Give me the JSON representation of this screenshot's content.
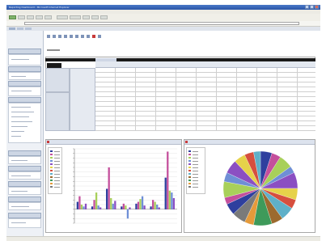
{
  "window": {
    "title": "Reporting Dashboard - Microsoft Internet Explorer"
  },
  "colors": {
    "palette": [
      "#2e3f9e",
      "#c44f9c",
      "#a8d05a",
      "#6f8fd6",
      "#8b4fc2",
      "#e6d24a",
      "#d64f3e",
      "#5fb0c8",
      "#9c6a2e",
      "#3e9a5a",
      "#e59a3a",
      "#7a7a7a"
    ]
  },
  "icons": [
    "back-icon",
    "forward-icon",
    "stop-icon",
    "refresh-icon",
    "home-icon",
    "search-icon",
    "favorites-icon",
    "history-icon",
    "mail-icon",
    "print-icon"
  ],
  "chart_data": [
    {
      "type": "bar",
      "categories": [
        "1",
        "2",
        "3",
        "4",
        "5",
        "6",
        "7"
      ],
      "series": [
        {
          "values": [
            8,
            3,
            22,
            3,
            6,
            3,
            34
          ]
        },
        {
          "values": [
            14,
            10,
            45,
            6,
            8,
            10,
            62
          ]
        },
        {
          "values": [
            5,
            18,
            12,
            4,
            11,
            8,
            20
          ]
        },
        {
          "values": [
            3,
            4,
            6,
            -10,
            14,
            5,
            18
          ]
        },
        {
          "values": [
            6,
            2,
            9,
            2,
            4,
            2,
            12
          ]
        }
      ],
      "ylim": [
        -15,
        65
      ]
    },
    {
      "type": "pie",
      "values": [
        5,
        4,
        6,
        3,
        7,
        5,
        4,
        6,
        5,
        8,
        4,
        6,
        5,
        3,
        7,
        4,
        6,
        5,
        4,
        3
      ]
    }
  ]
}
